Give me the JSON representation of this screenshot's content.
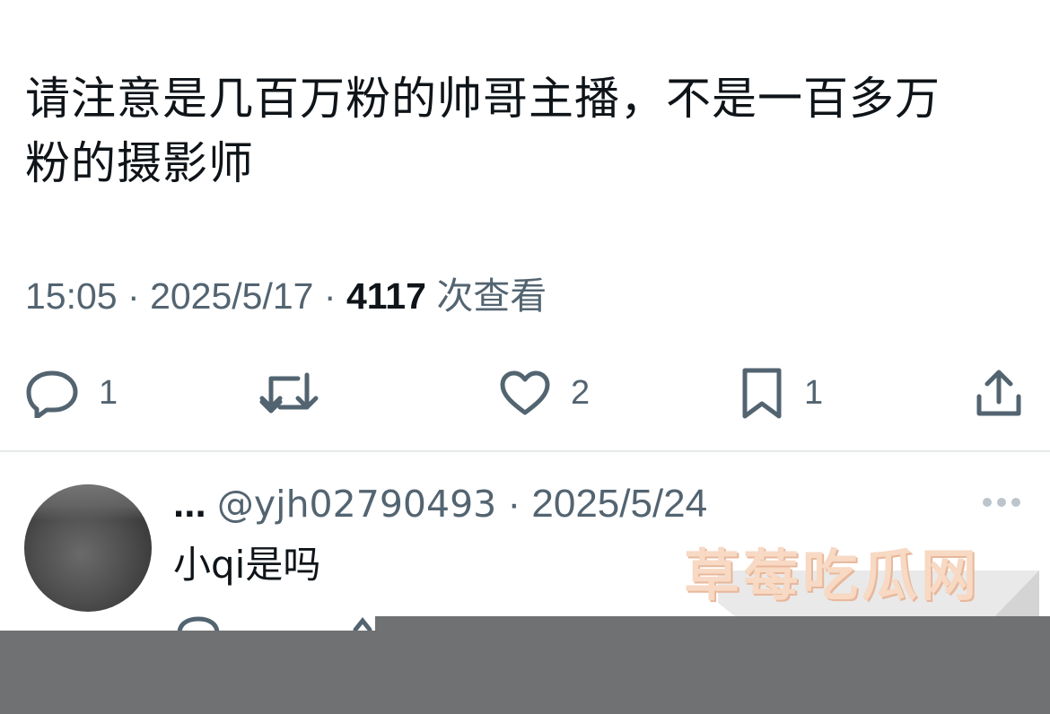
{
  "tweet": {
    "text_line1": "请注意是几百万粉的帅哥主播，不是一百多万",
    "text_line2": "粉的摄影师",
    "time": "15:05",
    "separator": "·",
    "date": "2025/5/17",
    "views_count": "4117",
    "views_label": "次查看"
  },
  "actions": {
    "reply_count": "1",
    "like_count": "2",
    "bookmark_count": "1",
    "icons": [
      "reply-icon",
      "retweet-icon",
      "like-icon",
      "bookmark-icon",
      "share-icon"
    ]
  },
  "reply": {
    "name": "...",
    "handle": "@yjh02790493",
    "separator": "·",
    "date": "2025/5/24",
    "text": "小qi是吗"
  },
  "watermark": {
    "text": "草莓吃瓜网"
  },
  "colors": {
    "text": "#0f1419",
    "secondary": "#536471",
    "divider": "#e6e9eb",
    "overlay": "#707173"
  }
}
